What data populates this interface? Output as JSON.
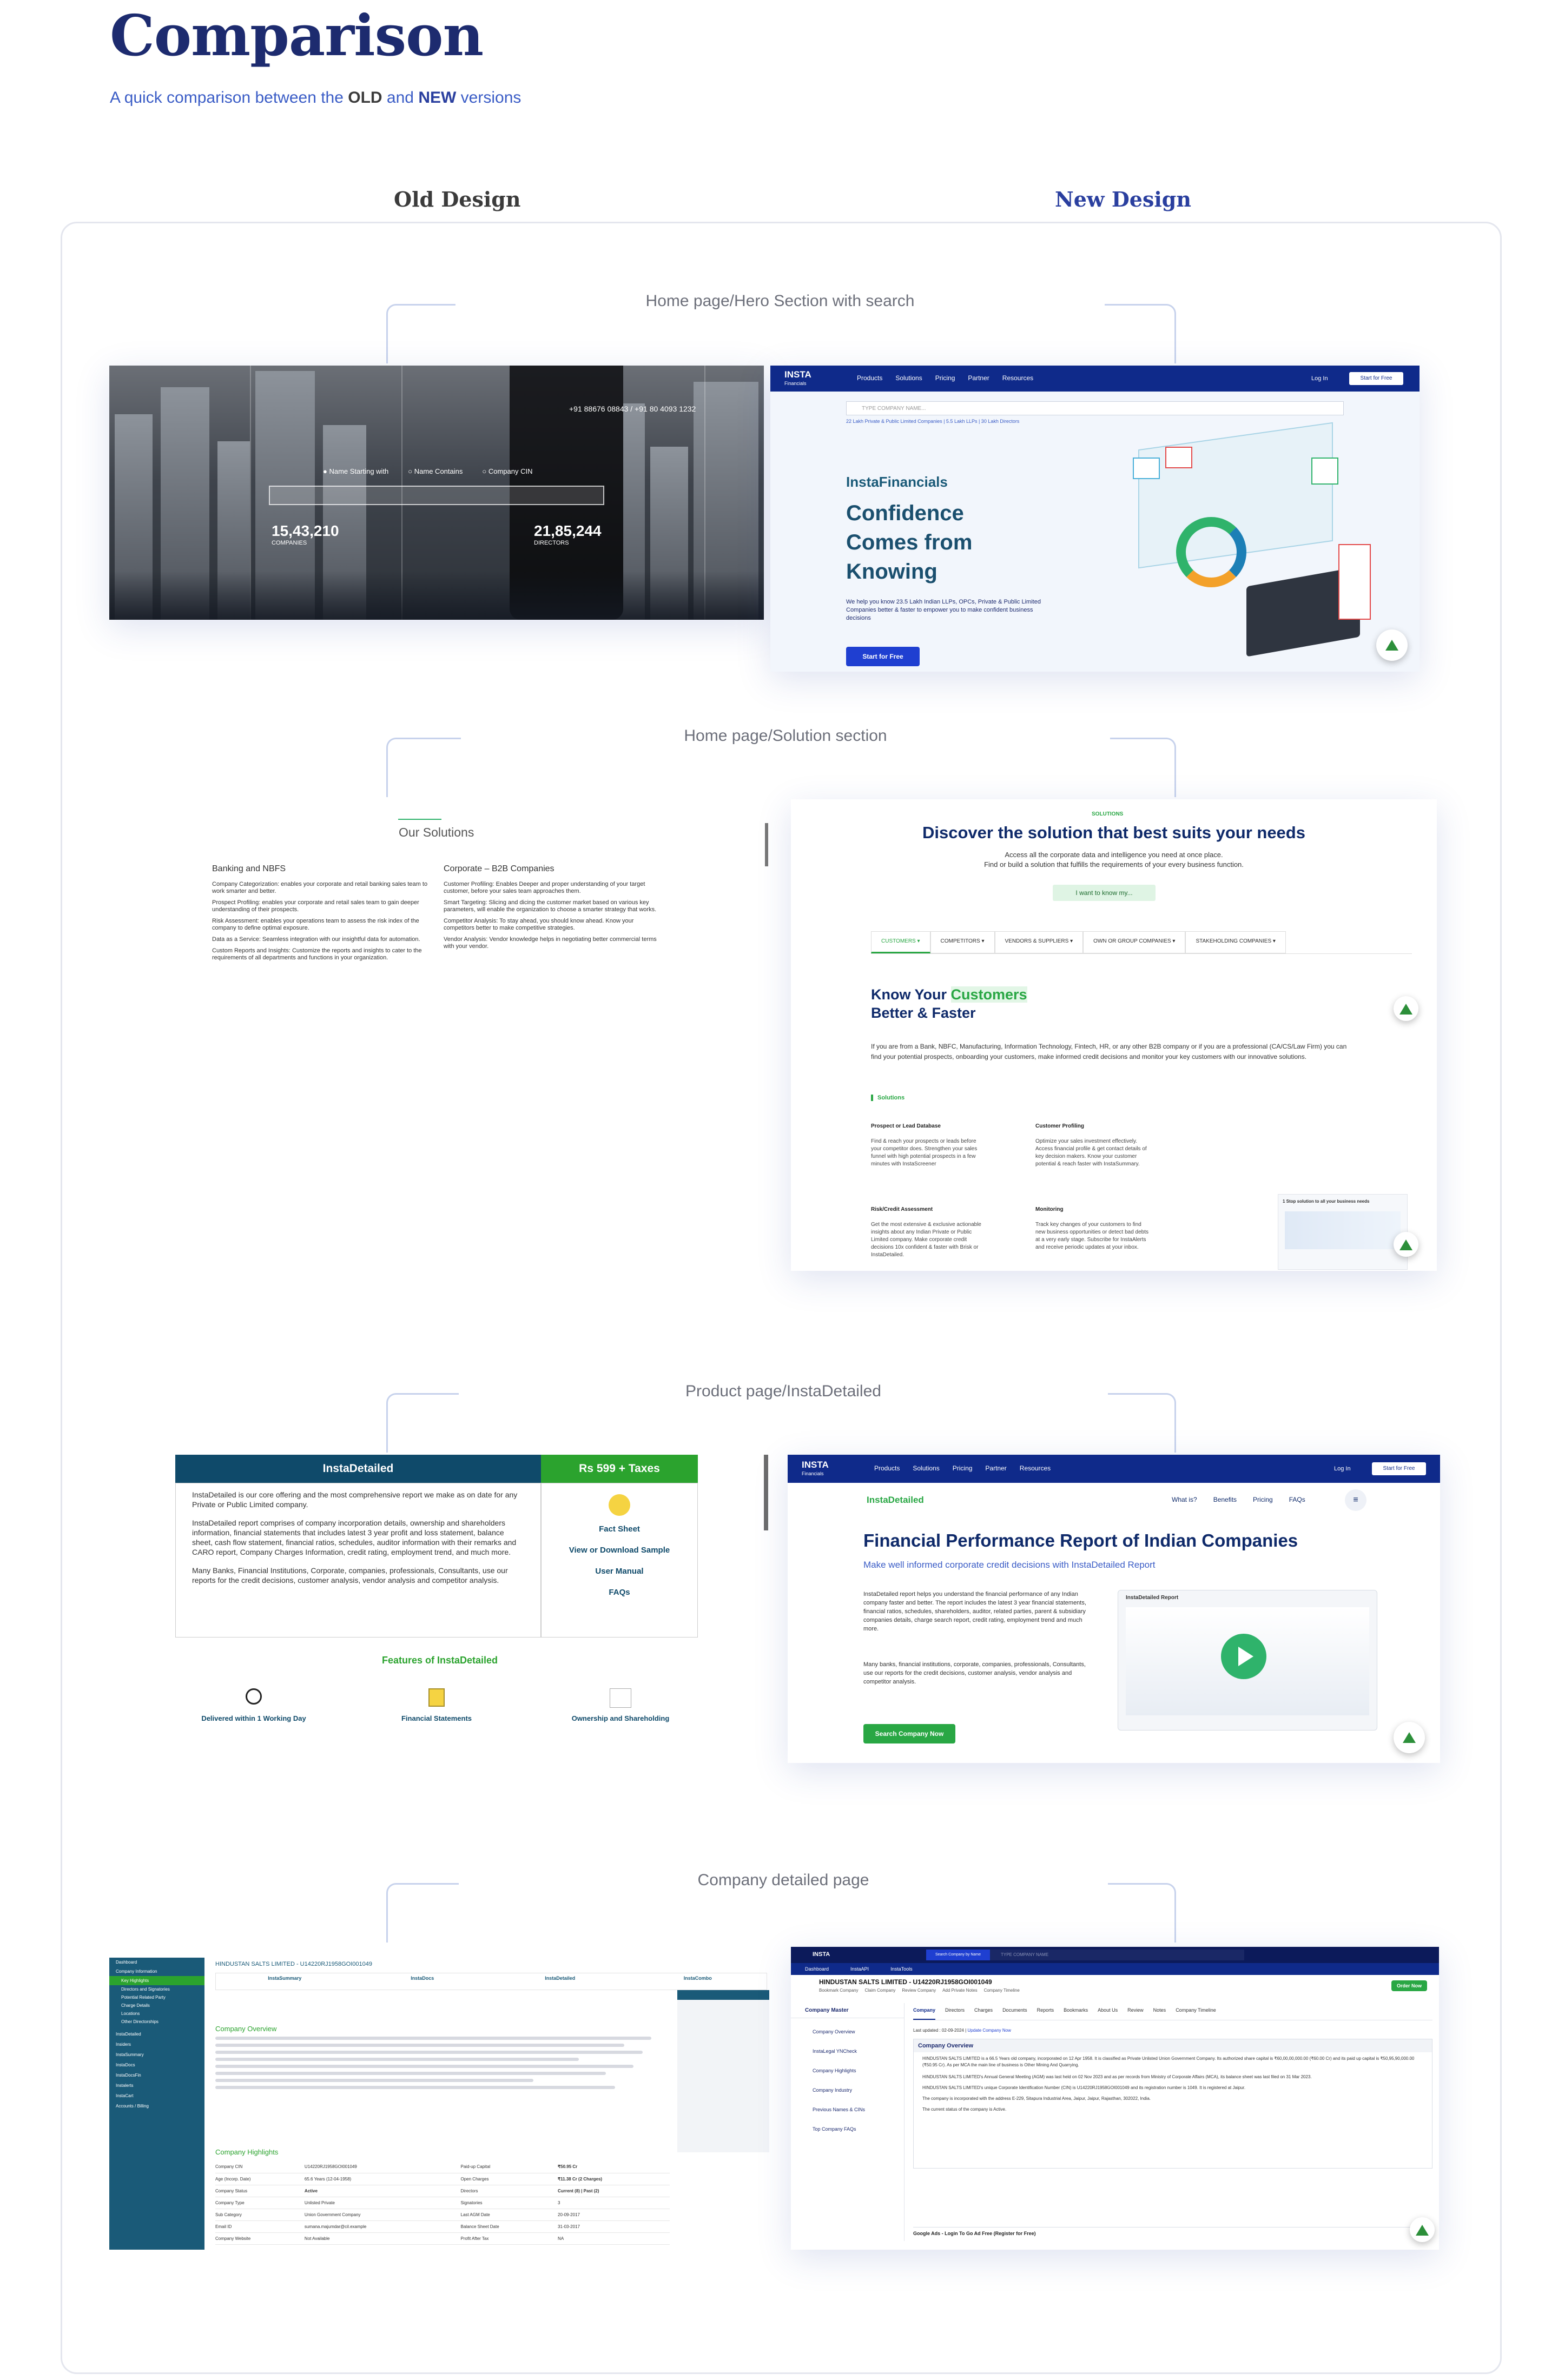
{
  "header": {
    "title": "Comparison",
    "subtitle_prefix": "A quick comparison between the ",
    "subtitle_old": "OLD",
    "subtitle_and": " and ",
    "subtitle_new": "NEW",
    "subtitle_suffix": " versions"
  },
  "columns": {
    "old": "Old Design",
    "new": "New Design"
  },
  "sections": [
    {
      "label": "Home page/Hero Section with search"
    },
    {
      "label": "Home page/Solution section"
    },
    {
      "label": "Product page/InstaDetailed"
    },
    {
      "label": "Company detailed page"
    }
  ],
  "old_hero": {
    "phone": "+91 88676 08843 / +91 80 4093 1232",
    "radio_1": "Name Starting with",
    "radio_2": "Name Contains",
    "radio_3": "Company CIN",
    "stat_1_value": "15,43,210",
    "stat_1_label": "COMPANIES",
    "stat_2_value": "21,85,244",
    "stat_2_label": "DIRECTORS"
  },
  "new_hero": {
    "logo": "INSTA",
    "logo_sub": "Financials",
    "nav": [
      "Products",
      "Solutions",
      "Pricing",
      "Partner",
      "Resources"
    ],
    "login": "Log In",
    "cta": "Start for Free",
    "search_placeholder": "TYPE COMPANY NAME...",
    "search_hint": "22 Lakh Private & Public Limited Companies | 5.5 Lakh LLPs | 30 Lakh Directors",
    "brand": "InstaFinancials",
    "headline_1": "Confidence",
    "headline_2": "Comes from",
    "headline_3": "Knowing",
    "body": "We help you know 23.5 Lakh Indian LLPs, OPCs, Private & Public Limited Companies better & faster to empower you to make confident business decisions",
    "button": "Start for Free"
  },
  "old_solutions": {
    "title": "Our Solutions",
    "col1_title": "Banking and NBFS",
    "col1_items": [
      "Company Categorization: enables your corporate and retail banking sales team to work smarter and better.",
      "Prospect Profiling: enables your corporate and retail sales team to gain deeper understanding of their prospects.",
      "Risk Assessment: enables your operations team to assess the risk index of the company to define optimal exposure.",
      "Data as a Service: Seamless integration with our insightful data for automation.",
      "Custom Reports and Insights: Customize the reports and insights to cater to the requirements of all departments and functions in your organization."
    ],
    "col2_title": "Corporate – B2B Companies",
    "col2_items": [
      "Customer Profiling: Enables Deeper and proper understanding of your target customer, before your sales team approaches them.",
      "Smart Targeting: Slicing and dicing the customer market based on various key parameters, will enable the organization to choose a smarter strategy that works.",
      "Competitor Analysis: To stay ahead, you should know ahead. Know your competitors better to make competitive strategies.",
      "Vendor Analysis: Vendor knowledge helps in negotiating better commercial terms with your vendor."
    ]
  },
  "new_solutions": {
    "eyebrow": "SOLUTIONS",
    "title": "Discover the solution that best suits your needs",
    "sub_1": "Access all the corporate data and intelligence you need at once place.",
    "sub_2": "Find or build a solution that fulfills the requirements of your every business function.",
    "button": "I want to know my...",
    "tabs": [
      "CUSTOMERS",
      "COMPETITORS",
      "VENDORS & SUPPLIERS",
      "OWN OR GROUP COMPANIES",
      "STAKEHOLDING COMPANIES"
    ],
    "heading_1": "Know Your ",
    "heading_highlight": "Customers",
    "heading_2": "Better & Faster",
    "para": "If you are from a Bank, NBFC, Manufacturing, Information Technology, Fintech, HR, or any other B2B company or if you are a professional (CA/CS/Law Firm) you can find your potential prospects, onboarding your customers, make informed credit decisions and monitor your key customers with our innovative solutions.",
    "solutions_label": "Solutions",
    "blocks": [
      {
        "title": "Prospect or Lead Database",
        "text": "Find & reach your prospects or leads before your competitor does. Strengthen your sales funnel with high potential prospects in a few minutes with InstaScreener"
      },
      {
        "title": "Customer Profiling",
        "text": "Optimize your sales investment effectively. Access financial profile & get contact details of key decision makers. Know your customer potential & reach faster with InstaSummary."
      },
      {
        "title": "Risk/Credit Assessment",
        "text": "Get the most extensive & exclusive actionable insights about any Indian Private or Public Limited company. Make corporate credit decisions 10x confident & faster with Brisk or InstaDetailed."
      },
      {
        "title": "Monitoring",
        "text": "Track key changes of your customers to find new business opportunities or detect bad debts at a very early stage. Subscribe for InstaAlerts and receive periodic updates at your inbox."
      }
    ],
    "card_label": "1 Stop solution to all your business needs"
  },
  "old_product": {
    "title": "InstaDetailed",
    "price": "Rs 599 + Taxes",
    "p1": "InstaDetailed is our core offering and the most comprehensive report we make as on date for any Private or Public Limited company.",
    "p2": "InstaDetailed report comprises of company incorporation details, ownership and shareholders information, financial statements that includes latest 3 year profit and loss statement, balance sheet, cash flow statement, financial ratios, schedules, auditor information with their remarks and CARO report, Company Charges Information, credit rating, employment trend, and much more.",
    "p3": "Many Banks, Financial Institutions, Corporate, companies, professionals, Consultants, use our reports for the credit decisions, customer analysis, vendor analysis and competitor analysis.",
    "links": [
      "Fact Sheet",
      "View or Download Sample",
      "User Manual",
      "FAQs"
    ],
    "features_title": "Features of InstaDetailed",
    "features": [
      "Delivered within 1 Working Day",
      "Financial Statements",
      "Ownership and Shareholding"
    ]
  },
  "new_product": {
    "nav": [
      "Products",
      "Solutions",
      "Pricing",
      "Partner",
      "Resources"
    ],
    "login": "Log In",
    "cta": "Start for Free",
    "sub_brand": "InstaDetailed",
    "sub_nav": [
      "What is?",
      "Benefits",
      "Pricing",
      "FAQs"
    ],
    "title": "Financial Performance Report of Indian Companies",
    "subtitle": "Make well informed corporate credit decisions with InstaDetailed Report",
    "p1": "InstaDetailed report helps you understand the financial performance of any Indian company faster and better. The report includes the latest 3 year financial statements, financial ratios, schedules, shareholders, auditor, related parties, parent & subsidiary companies details, charge search report, credit rating, employment trend and much more.",
    "p2": "Many banks, financial institutions, corporate, companies, professionals, Consultants, use our reports for the credit decisions, customer analysis, vendor analysis and competitor analysis.",
    "button": "Search Company Now",
    "report_label": "InstaDetailed Report"
  },
  "old_company": {
    "company": "HINDUSTAN SALTS LIMITED - U14220RJ1958GOI001049",
    "sidebar": [
      "Dashboard",
      "Company Information",
      "Key Highlights",
      "Directors and Signatories",
      "Potential Related Party",
      "Charge Details",
      "Locations",
      "Other Directorships",
      "InstaDetailed",
      "Insiders",
      "InstaSummary",
      "InstaDocs",
      "InstaDocsFin",
      "Instalerts",
      "InstaCart",
      "Accounts / Billing"
    ],
    "products": [
      "InstaSummary",
      "InstaDocs",
      "InstaDetailed",
      "InstaCombo"
    ],
    "overview_title": "Company Overview",
    "highlights": "Company Highlights",
    "rows": [
      [
        "Company CIN",
        "U14220RJ1958GOI001049",
        "Paid-up Capital",
        "₹50.95 Cr"
      ],
      [
        "Age (Incorp. Date)",
        "65.6 Years (12-04-1958)",
        "Open Charges",
        "₹11.38 Cr (2 Charges)"
      ],
      [
        "Company Status",
        "Active",
        "Directors",
        "Current (8) | Past (2)"
      ],
      [
        "Company Type",
        "Unlisted Private",
        "Signatories",
        "3"
      ],
      [
        "Sub Category",
        "Union Government Company",
        "Last AGM Date",
        "20-09-2017"
      ],
      [
        "Email ID",
        "sumana.majumdar@cil.example",
        "Balance Sheet Date",
        "31-03-2017"
      ],
      [
        "Company Website",
        "Not Available",
        "Profit After Tax",
        "NA"
      ]
    ]
  },
  "new_company": {
    "search_btn": "Search Company by Name",
    "search_placeholder": "TYPE COMPANY NAME",
    "tabs_top": [
      "Dashboard",
      "InstaAPI",
      "InstaTools"
    ],
    "company": "HINDUSTAN SALTS LIMITED - U14220RJ1958GOI001049",
    "actions": [
      "Bookmark Company",
      "Claim Company",
      "Review Company",
      "Add Private Notes",
      "Company Timeline"
    ],
    "order": "Order Now",
    "left_menu_title": "Company Master",
    "left_menu": [
      "Company Overview",
      "InstaLegal YNCheck",
      "Company Highlights",
      "Company Industry",
      "Previous Names & CINs",
      "Top Company FAQs"
    ],
    "tabs": [
      "Company",
      "Directors",
      "Charges",
      "Documents",
      "Reports",
      "Bookmarks",
      "About Us",
      "Review",
      "Notes",
      "Company Timeline"
    ],
    "last_updated": "Last updated : 02-09-2024 |",
    "update_link": "Update Company Now",
    "overview_title": "Company Overview",
    "p1": "HINDUSTAN SALTS LIMITED is a 66.5 Years old company, incorporated on 12 Apr 1958. It is classified as Private Unlisted Union Government Company. Its authorized share capital is ₹60,00,00,000.00 (₹60.00 Cr) and its paid up capital is ₹50,95,90,000.00 (₹50.95 Cr). As per MCA the main line of business is Other Mining And Quarrying.",
    "p2": "HINDUSTAN SALTS LIMITED's Annual General Meeting (AGM) was last held on 02 Nov 2023 and as per records from Ministry of Corporate Affairs (MCA), its balance sheet was last filed on 31 Mar 2023.",
    "p3": "HINDUSTAN SALTS LIMITED's unique Corporate Identification Number (CIN) is U14220RJ1958GOI001049 and its registration number is 1049. It is registered at Jaipur.",
    "p4": "The company is incorporated with the address E-229, Sitapura Industrial Area, Jaipur, Jaipur, Rajasthan, 302022, India.",
    "p5": "The current status of the company is Active.",
    "ads": "Google Ads - Login To Go Ad Free (Register for Free)"
  },
  "colors": {
    "title": "#1d2b6f",
    "accent": "#3a5cc6",
    "nav_blue": "#0f2a8a",
    "green": "#29a744",
    "teal": "#1a5a78"
  }
}
